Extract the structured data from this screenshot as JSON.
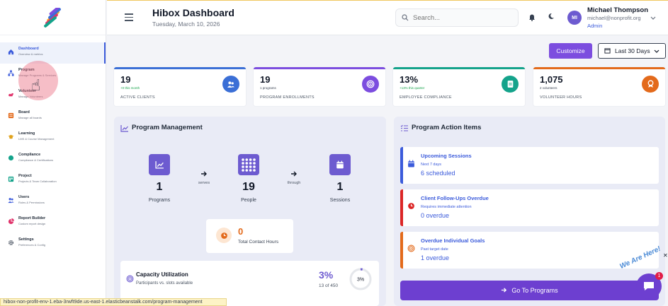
{
  "header": {
    "title": "Hibox Dashboard",
    "date": "Tuesday, March 10, 2026",
    "search_placeholder": "Search...",
    "user": {
      "initials": "MI",
      "name": "Michael Thompson",
      "email": "michael@nonprofit.org",
      "role": "Admin"
    }
  },
  "sidebar": {
    "items": [
      {
        "title": "Dashboard",
        "sub": "Overview & metrics",
        "icon": "home-icon",
        "color": "#3b5bdb"
      },
      {
        "title": "Program",
        "sub": "Manage Programs & Services",
        "icon": "sitemap-icon",
        "color": "#3b5bdb"
      },
      {
        "title": "Volunteer",
        "sub": "Manage Volunteers",
        "icon": "volunteer-icon",
        "color": "#e0336b"
      },
      {
        "title": "Board",
        "sub": "Manage all boards",
        "icon": "board-icon",
        "color": "#e36a1b"
      },
      {
        "title": "Learning",
        "sub": "LMS & Course Management",
        "icon": "graduation-icon",
        "color": "#e0a21b"
      },
      {
        "title": "Compliance",
        "sub": "Compliance & Certifications",
        "icon": "compliance-icon",
        "color": "#14a38b"
      },
      {
        "title": "Project",
        "sub": "Projects & Team Collaboration",
        "icon": "project-icon",
        "color": "#14a38b"
      },
      {
        "title": "Users",
        "sub": "Roles & Permissions",
        "icon": "users-icon",
        "color": "#3b5bdb"
      },
      {
        "title": "Report Builder",
        "sub": "Custom report design",
        "icon": "report-icon",
        "color": "#e0336b"
      },
      {
        "title": "Settings",
        "sub": "Preferences & Config",
        "icon": "gear-icon",
        "color": "#374151"
      }
    ]
  },
  "actions": {
    "customize": "Customize",
    "date_range": "Last 30 Days"
  },
  "stats": [
    {
      "value": "19",
      "sub": "+0 this month",
      "label": "ACTIVE CLIENTS",
      "color": "#3b6fd6",
      "sub_color": "#16a34a",
      "icon": "users-icon"
    },
    {
      "value": "19",
      "sub": "1 programs",
      "label": "PROGRAM ENROLLMENTS",
      "color": "#7c4ddf",
      "sub_color": "#374151",
      "icon": "target-icon"
    },
    {
      "value": "13%",
      "sub": "+13% this quarter",
      "label": "EMPLOYEE COMPLIANCE",
      "color": "#14a38b",
      "sub_color": "#16a34a",
      "icon": "clipboard-icon"
    },
    {
      "value": "1,075",
      "sub": "2 volunteers",
      "label": "VOLUNTEER HOURS",
      "color": "#e36a1b",
      "sub_color": "#374151",
      "icon": "ribbon-icon"
    }
  ],
  "program_management": {
    "title": "Program Management",
    "flow": [
      {
        "value": "1",
        "label": "Programs"
      },
      {
        "value": "19",
        "label": "People"
      },
      {
        "value": "1",
        "label": "Sessions"
      }
    ],
    "connectors": [
      "serves",
      "through"
    ],
    "contact_hours": {
      "value": "0",
      "label": "Total Contact Hours"
    },
    "capacity": {
      "title": "Capacity Utilization",
      "sub": "Participants vs. slots available",
      "percent": "3%",
      "count": "13 of 450",
      "ring_label": "3%",
      "fraction": 0.03
    }
  },
  "action_items": {
    "title": "Program Action Items",
    "items": [
      {
        "title": "Upcoming Sessions",
        "sub": "Next 7 days",
        "count": "6 scheduled",
        "color": "#3b5bdb",
        "icon": "calendar-icon"
      },
      {
        "title": "Client Follow-Ups Overdue",
        "sub": "Requires immediate attention",
        "count": "0 overdue",
        "color": "#dc2626",
        "icon": "clock-icon"
      },
      {
        "title": "Overdue Individual Goals",
        "sub": "Past target date",
        "count": "1 overdue",
        "color": "#e36a1b",
        "icon": "target-icon"
      }
    ],
    "go_button": "Go To Programs"
  },
  "statusbar": "hibox-non-profit-env-1.eba-3rwft9de.us-east-1.elasticbeanstalk.com/program-management",
  "chat": {
    "badge": "1",
    "tag": "We Are Here!"
  }
}
